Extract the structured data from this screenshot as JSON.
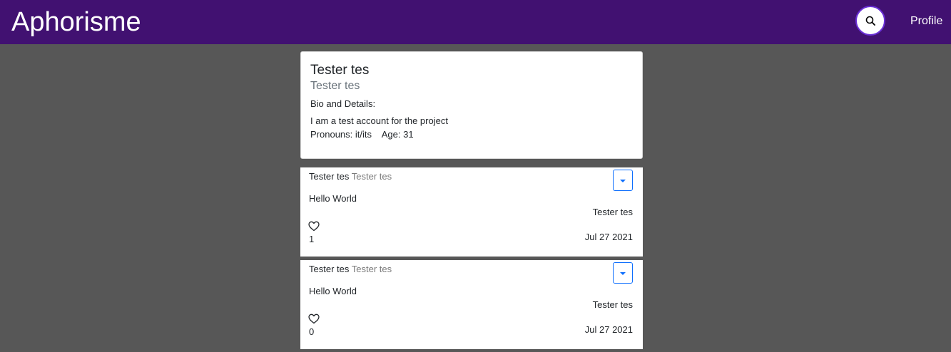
{
  "navbar": {
    "brand": "Aphorisme",
    "search_icon": "search-icon",
    "profile_label": "Profile"
  },
  "profile": {
    "name": "Tester tes",
    "handle": "Tester tes",
    "bio_label": "Bio and Details:",
    "bio": "I am a test account for the project",
    "pronouns_text": "Pronouns: it/its",
    "age_text": "Age: 31"
  },
  "posts": [
    {
      "author_name": "Tester tes",
      "author_handle": "Tester tes",
      "content": "Hello World",
      "signature": "Tester tes",
      "likes": "1",
      "date": "Jul 27 2021"
    },
    {
      "author_name": "Tester tes",
      "author_handle": "Tester tes",
      "content": "Hello World",
      "signature": "Tester tes",
      "likes": "0",
      "date": "Jul 27 2021"
    }
  ],
  "colors": {
    "navbar_bg": "#411171",
    "page_bg": "#575757",
    "accent": "#0d6efd"
  }
}
